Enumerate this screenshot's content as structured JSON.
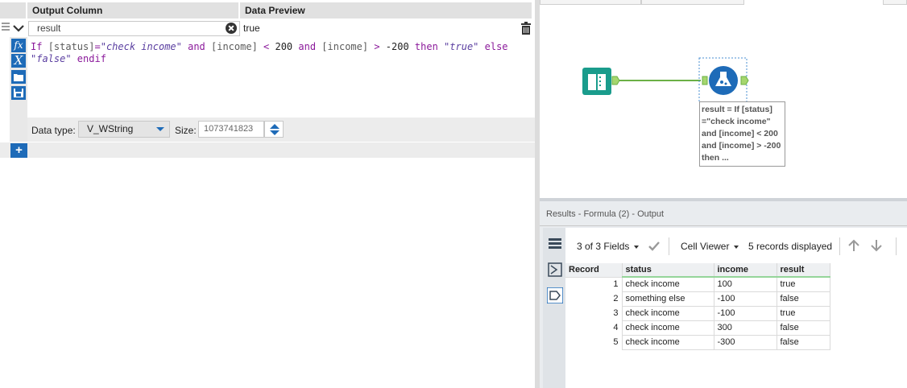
{
  "headers": {
    "output_column": "Output Column",
    "data_preview": "Data Preview"
  },
  "row": {
    "output_value": "result",
    "preview_value": "true",
    "expression": {
      "t1": "If ",
      "t2": "[status]",
      "t3": "=",
      "t4": "\"check income\"",
      "t5": " and ",
      "t6": "[income]",
      "t7": " < ",
      "t8": "200",
      "t9": " and ",
      "t10": "[income]",
      "t11": " > ",
      "t12": "-200",
      "t13": " then ",
      "t14": "\"true\"",
      "t15": " else",
      "t16": "\"false\"",
      "t17": " endif"
    },
    "data_type_label": "Data type:",
    "data_type_value": "V_WString",
    "size_label": "Size:",
    "size_value": "1073741823"
  },
  "gutter_icons": [
    "function-icon",
    "variable-icon",
    "open-folder-icon",
    "save-icon"
  ],
  "add_label": "+",
  "workflow": {
    "annotation": "result = If [status] =\"check income\" and [income] < 200 and [income] > -200 then ..."
  },
  "results": {
    "title": "Results - Formula (2) - Output",
    "fields_label": "3 of 3 Fields",
    "cell_viewer_label": "Cell Viewer",
    "records_label": "5 records displayed",
    "columns": [
      "Record",
      "status",
      "income",
      "result"
    ],
    "rows": [
      [
        "1",
        "check income",
        "100",
        "true"
      ],
      [
        "2",
        "something else",
        "-100",
        "false"
      ],
      [
        "3",
        "check income",
        "-100",
        "true"
      ],
      [
        "4",
        "check income",
        "300",
        "false"
      ],
      [
        "5",
        "check income",
        "-300",
        "false"
      ]
    ]
  },
  "colors": {
    "accent": "#1e6bb8",
    "connector_green": "#7ec24e",
    "node_teal": "#1a9c8c"
  }
}
